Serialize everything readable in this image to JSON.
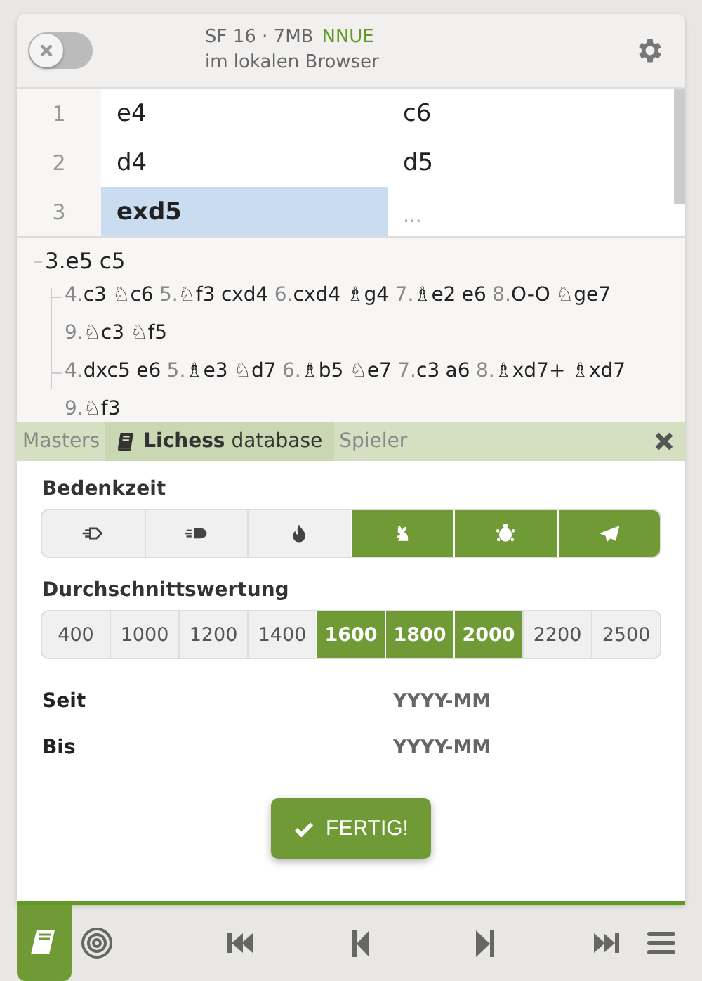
{
  "engine": {
    "on": false,
    "title": "SF 16 · 7MB",
    "badge": "NNUE",
    "subtitle": "im lokalen Browser"
  },
  "moves": [
    {
      "number": "1",
      "white": {
        "text": "e4",
        "selected": false
      },
      "black": {
        "text": "c6",
        "selected": false
      }
    },
    {
      "number": "2",
      "white": {
        "text": "d4",
        "selected": false
      },
      "black": {
        "text": "d5",
        "selected": false
      }
    },
    {
      "number": "3",
      "white": {
        "text": "exd5",
        "selected": true
      },
      "black": {
        "text": "...",
        "kind": "empty"
      }
    }
  ],
  "tree": {
    "moves": [
      {
        "n": "3.",
        "m": "e5"
      },
      {
        "m": "c5"
      }
    ],
    "children": [
      {
        "moves": [
          {
            "n": "4.",
            "m": "c3"
          },
          {
            "m": "♘c6"
          },
          {
            "n": "5.",
            "m": "♘f3"
          },
          {
            "m": "cxd4"
          },
          {
            "n": "6.",
            "m": "cxd4"
          },
          {
            "m": "♗g4"
          },
          {
            "n": "7.",
            "m": "♗e2"
          },
          {
            "m": "e6"
          },
          {
            "n": "8.",
            "m": "O-O"
          },
          {
            "m": "♘ge7"
          },
          {
            "n": "9.",
            "m": "♘c3"
          },
          {
            "m": "♘f5"
          }
        ]
      },
      {
        "moves": [
          {
            "n": "4.",
            "m": "dxc5"
          },
          {
            "m": "e6"
          },
          {
            "n": "5.",
            "m": "♗e3"
          },
          {
            "m": "♘d7"
          },
          {
            "n": "6.",
            "m": "♗b5"
          },
          {
            "m": "♘e7"
          },
          {
            "n": "7.",
            "m": "c3"
          },
          {
            "m": "a6"
          },
          {
            "n": "8.",
            "m": "♗xd7+"
          },
          {
            "m": "♗xd7"
          },
          {
            "n": "9.",
            "m": "♘f3"
          }
        ]
      }
    ]
  },
  "explorer_tabs": [
    {
      "label": "Masters",
      "selected": false
    },
    {
      "label": "**Lichess** database",
      "selected": true
    },
    {
      "label": "Spieler",
      "selected": false
    }
  ],
  "time_label": "Bedenkzeit",
  "time_controls": [
    {
      "kind": "ultrabullet",
      "selected": false
    },
    {
      "kind": "bullet",
      "selected": false
    },
    {
      "kind": "blitz",
      "selected": false
    },
    {
      "kind": "rapid",
      "selected": true
    },
    {
      "kind": "classical",
      "selected": true
    },
    {
      "kind": "correspondence",
      "selected": true
    }
  ],
  "rating_label": "Durchschnittswertung",
  "ratings": [
    {
      "label": "400",
      "selected": false
    },
    {
      "label": "1000",
      "selected": false
    },
    {
      "label": "1200",
      "selected": false
    },
    {
      "label": "1400",
      "selected": false
    },
    {
      "label": "1600",
      "selected": true
    },
    {
      "label": "1800",
      "selected": true
    },
    {
      "label": "2000",
      "selected": true
    },
    {
      "label": "2200",
      "selected": false
    },
    {
      "label": "2500",
      "selected": false
    }
  ],
  "since": {
    "label": "Seit",
    "placeholder": "YYYY-MM"
  },
  "until": {
    "label": "Bis",
    "placeholder": "YYYY-MM"
  },
  "done_button": "FERTIG!",
  "bottom_bar": [
    {
      "kind": "book",
      "selected": true
    },
    {
      "kind": "target",
      "selected": false
    },
    {
      "kind": "first",
      "selected": false
    },
    {
      "kind": "prev",
      "selected": false
    },
    {
      "kind": "next",
      "selected": false
    },
    {
      "kind": "last",
      "selected": false
    },
    {
      "kind": "menu",
      "selected": false
    }
  ]
}
